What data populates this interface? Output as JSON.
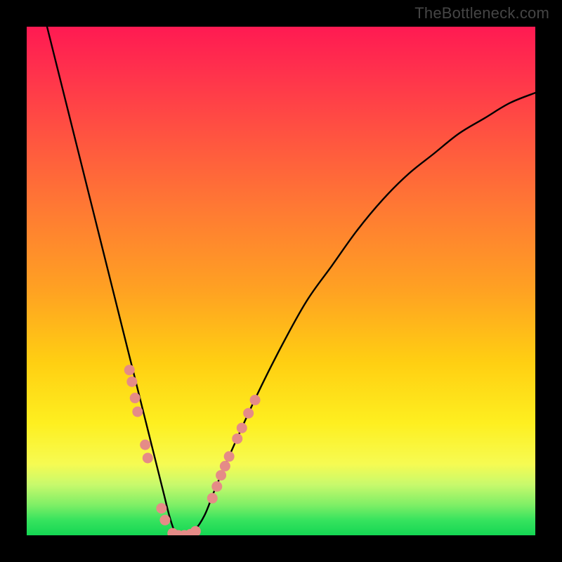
{
  "watermark": "TheBottleneck.com",
  "chart_data": {
    "type": "line",
    "title": "",
    "xlabel": "",
    "ylabel": "",
    "xlim": [
      0,
      100
    ],
    "ylim": [
      0,
      100
    ],
    "series": [
      {
        "name": "bottleneck-curve",
        "x": [
          4,
          6,
          8,
          10,
          12,
          14,
          16,
          18,
          20,
          22,
          24,
          26,
          27,
          28,
          29,
          30,
          31,
          33,
          35,
          37,
          40,
          45,
          50,
          55,
          60,
          65,
          70,
          75,
          80,
          85,
          90,
          95,
          100
        ],
        "y": [
          100,
          92,
          84,
          76,
          68,
          60,
          52,
          44,
          36,
          28,
          20,
          12,
          8,
          4,
          1,
          0,
          0,
          1,
          4,
          9,
          16,
          27,
          37,
          46,
          53,
          60,
          66,
          71,
          75,
          79,
          82,
          85,
          87
        ]
      }
    ],
    "marker_points": {
      "name": "highlight-dots",
      "color": "#e58b87",
      "points": [
        {
          "x": 20.2,
          "y": 32.5
        },
        {
          "x": 20.7,
          "y": 30.2
        },
        {
          "x": 21.3,
          "y": 27.0
        },
        {
          "x": 21.8,
          "y": 24.3
        },
        {
          "x": 23.3,
          "y": 17.8
        },
        {
          "x": 23.8,
          "y": 15.2
        },
        {
          "x": 26.5,
          "y": 5.3
        },
        {
          "x": 27.2,
          "y": 3.0
        },
        {
          "x": 28.7,
          "y": 0.4
        },
        {
          "x": 29.8,
          "y": 0.0
        },
        {
          "x": 31.0,
          "y": 0.0
        },
        {
          "x": 32.2,
          "y": 0.2
        },
        {
          "x": 33.2,
          "y": 0.8
        },
        {
          "x": 36.5,
          "y": 7.3
        },
        {
          "x": 37.4,
          "y": 9.6
        },
        {
          "x": 38.2,
          "y": 11.8
        },
        {
          "x": 39.0,
          "y": 13.6
        },
        {
          "x": 39.8,
          "y": 15.5
        },
        {
          "x": 41.4,
          "y": 19.0
        },
        {
          "x": 42.3,
          "y": 21.1
        },
        {
          "x": 43.6,
          "y": 24.0
        },
        {
          "x": 44.9,
          "y": 26.6
        }
      ]
    }
  }
}
